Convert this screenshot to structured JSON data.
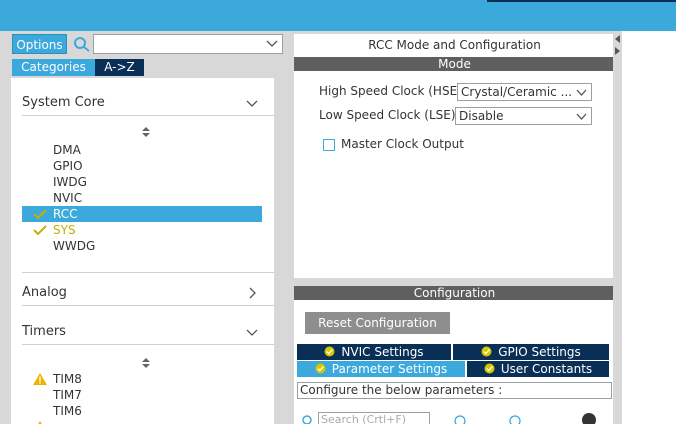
{
  "left": {
    "options_label": "Options",
    "search": {
      "value": "",
      "placeholder": ""
    },
    "tabs": {
      "categories": "Categories",
      "az": "A->Z"
    },
    "sections": {
      "system_core": "System Core",
      "analog": "Analog",
      "timers": "Timers"
    },
    "system_core_items": [
      "DMA",
      "GPIO",
      "IWDG",
      "NVIC",
      "RCC",
      "SYS",
      "WWDG"
    ],
    "timers_items": [
      "TIM8",
      "TIM7",
      "TIM6"
    ]
  },
  "mode_panel": {
    "title": "RCC Mode and Configuration",
    "mode_header": "Mode",
    "hse_label": "High Speed Clock (HSE)",
    "hse_value": "Crystal/Ceramic ...",
    "lse_label": "Low Speed Clock (LSE)",
    "lse_value": "Disable",
    "mco_label": "Master Clock Output"
  },
  "config_panel": {
    "header": "Configuration",
    "reset_label": "Reset Configuration",
    "tabs": {
      "nvic": "NVIC Settings",
      "gpio": "GPIO Settings",
      "parameter": "Parameter Settings",
      "user_constants": "User Constants"
    },
    "hint": "Configure the below parameters :",
    "search_placeholder": "Search (Crtl+F)"
  },
  "colors": {
    "accent": "#3ca9dd",
    "navy": "#0a2f57",
    "ok": "#c2b100",
    "warn": "#f0b400"
  }
}
